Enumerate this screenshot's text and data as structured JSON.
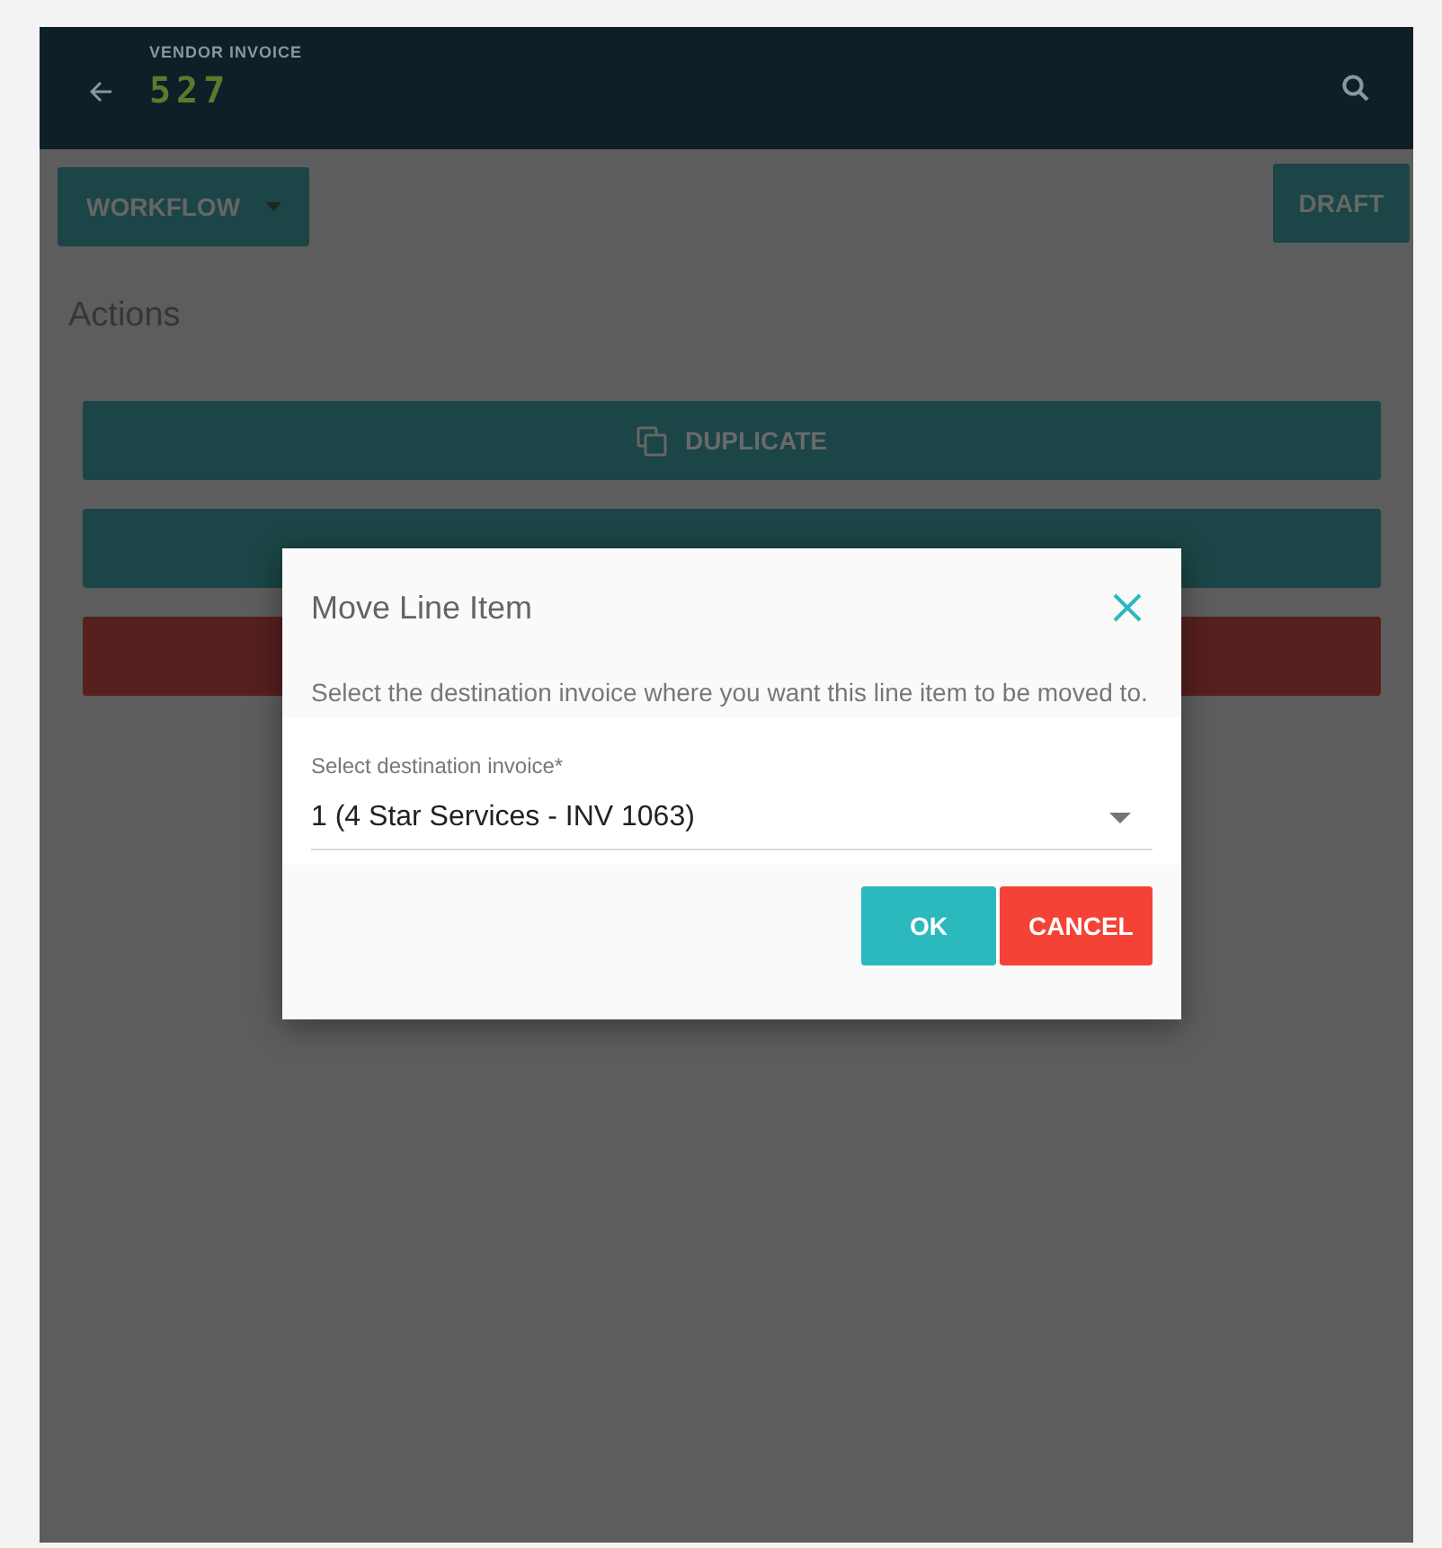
{
  "header": {
    "subtitle": "VENDOR INVOICE",
    "title": "527"
  },
  "toolbar": {
    "workflow_button": "WORKFLOW",
    "status_button": "DRAFT"
  },
  "actions": {
    "title": "Actions",
    "buttons": [
      {
        "label": "DUPLICATE",
        "kind": "duplicate"
      },
      {
        "kind": "move"
      },
      {
        "kind": "delete"
      }
    ]
  },
  "dialog": {
    "title": "Move Line Item",
    "description": "Select the destination invoice where you want this line item to be moved to.",
    "field": {
      "label": "Select destination invoice*",
      "value": "1 (4 Star Services - INV 1063)"
    },
    "buttons": [
      {
        "label": "OK",
        "kind": "primary"
      },
      {
        "label": "CANCEL",
        "kind": "danger"
      }
    ]
  }
}
